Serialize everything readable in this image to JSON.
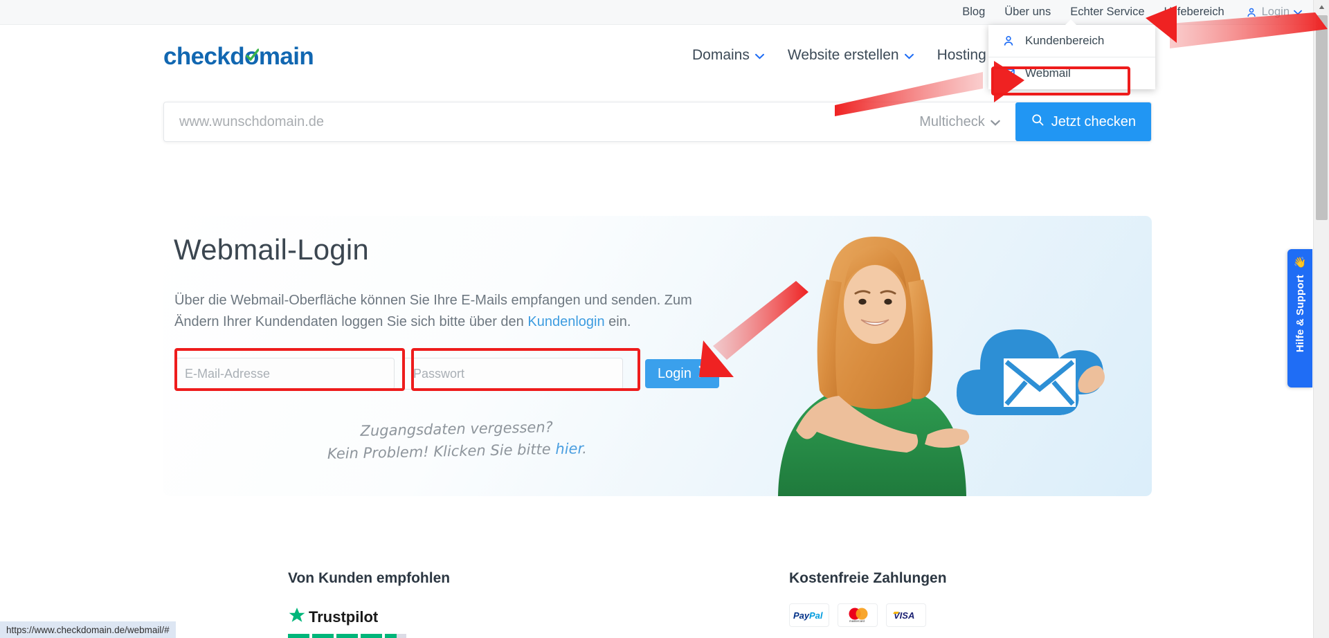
{
  "topbar": {
    "links": [
      {
        "label": "Blog"
      },
      {
        "label": "Über uns"
      },
      {
        "label": "Echter Service"
      },
      {
        "label": "Hilfebereich"
      }
    ],
    "login": {
      "label": "Login",
      "icon": "person-icon",
      "caret": "chevron-down-icon"
    }
  },
  "login_dropdown": {
    "items": [
      {
        "label": "Kundenbereich",
        "icon": "person-icon"
      },
      {
        "label": "Webmail",
        "icon": "envelope-icon"
      }
    ]
  },
  "header": {
    "logo_text": "checkdomain",
    "logo_brand_color": "#1167b1",
    "logo_check_color": "#3cb54a",
    "nav": [
      {
        "label": "Domains",
        "caret": true
      },
      {
        "label": "Website erstellen",
        "caret": true
      },
      {
        "label": "Hosting",
        "caret": false
      }
    ]
  },
  "search": {
    "placeholder": "www.wunschdomain.de",
    "value": "",
    "multicheck_label": "Multicheck",
    "button_label": "Jetzt checken",
    "button_icon": "search-icon",
    "button_color": "#2196f3"
  },
  "hero": {
    "title": "Webmail-Login",
    "paragraph_part1": "Über die Webmail-Oberfläche können Sie Ihre E-Mails empfangen und senden. Zum Ändern Ihrer Kundendaten loggen Sie sich bitte über den ",
    "paragraph_link": "Kundenlogin",
    "paragraph_part2": " ein.",
    "email_placeholder": "E-Mail-Adresse",
    "email_value": "",
    "password_placeholder": "Passwort",
    "password_value": "",
    "login_button_label": "Login",
    "forgot_line1": "Zugangsdaten vergessen?",
    "forgot_line2_pre": "Kein Problem! Klicken Sie bitte ",
    "forgot_link": "hier",
    "forgot_line2_post": "."
  },
  "trust": {
    "heading": "Von Kunden empfohlen",
    "logo_label": "Trustpilot",
    "star_color": "#00b67a",
    "bars_filled": 4,
    "bars_total": 5,
    "partial_bar": true
  },
  "payments": {
    "heading": "Kostenfreie Zahlungen",
    "methods": [
      {
        "name": "PayPal"
      },
      {
        "name": "mastercard"
      },
      {
        "name": "VISA"
      }
    ]
  },
  "support_tab": {
    "label": "Hilfe & Support",
    "icon": "waving-hand-icon",
    "color": "#1f6df5"
  },
  "statusbar": {
    "url": "https://www.checkdomain.de/webmail/#"
  },
  "annotations": {
    "highlight_color": "#ee1c1c",
    "boxes": [
      "webmail-menu-item",
      "email-field",
      "password-field"
    ],
    "arrows": [
      "to-login-menu",
      "to-webmail-item",
      "to-login-button"
    ]
  }
}
